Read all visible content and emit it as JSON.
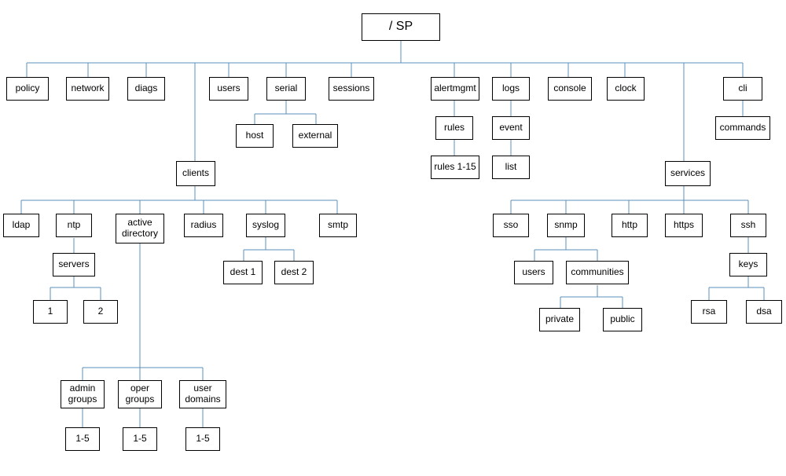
{
  "root": "/ SP",
  "policy": "policy",
  "network": "network",
  "diags": "diags",
  "users": "users",
  "serial": "serial",
  "serial_host": "host",
  "serial_external": "external",
  "sessions": "sessions",
  "alertmgmt": "alertmgmt",
  "alertmgmt_rules": "rules",
  "alertmgmt_rules_1_15": "rules 1-15",
  "logs": "logs",
  "logs_event": "event",
  "logs_list": "list",
  "console": "console",
  "clock": "clock",
  "cli": "cli",
  "cli_commands": "commands",
  "clients": "clients",
  "ldap": "ldap",
  "ntp": "ntp",
  "ntp_servers": "servers",
  "ntp_servers_1": "1",
  "ntp_servers_2": "2",
  "active_directory": "active\ndirectory",
  "ad_admin_groups": "admin\ngroups",
  "ad_oper_groups": "oper\ngroups",
  "ad_user_domains": "user\ndomains",
  "ad_1_5_a": "1-5",
  "ad_1_5_b": "1-5",
  "ad_1_5_c": "1-5",
  "radius": "radius",
  "syslog": "syslog",
  "syslog_dest1": "dest 1",
  "syslog_dest2": "dest 2",
  "smtp": "smtp",
  "services": "services",
  "sso": "sso",
  "snmp": "snmp",
  "snmp_users": "users",
  "snmp_communities": "communities",
  "snmp_private": "private",
  "snmp_public": "public",
  "http": "http",
  "https": "https",
  "ssh": "ssh",
  "ssh_keys": "keys",
  "ssh_rsa": "rsa",
  "ssh_dsa": "dsa"
}
